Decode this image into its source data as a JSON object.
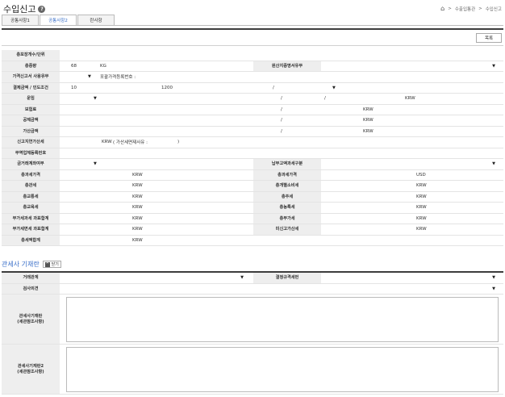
{
  "header": {
    "title": "수입신고",
    "breadcrumb": [
      "수출입통관",
      "수입신고"
    ]
  },
  "tabs": [
    {
      "label": "공통사항1",
      "active": false
    },
    {
      "label": "공통사항2",
      "active": true
    },
    {
      "label": "란사항",
      "active": false
    }
  ],
  "toolbar": {
    "close_label": "목록"
  },
  "form": {
    "total_pkg": {
      "label": "총포장개수/단위",
      "value": ""
    },
    "total_weight": {
      "label": "총중량",
      "value": "68",
      "unit": "KG"
    },
    "origin_cert": {
      "label": "원산지증명서유무",
      "value": ""
    },
    "price_decl": {
      "label": "가격신고서 사용유무",
      "value": "",
      "note": "포괄가격등록번호 :"
    },
    "settlement": {
      "label": "결제금액 / 인도조건",
      "value1": "10",
      "value2": "1200",
      "sep1": "/",
      "sep2": ""
    },
    "freight": {
      "label": "운임",
      "sep1": "/",
      "sep2": "/",
      "unit": "KRW"
    },
    "insurance": {
      "label": "보험료",
      "sep": "/",
      "unit": "KRW"
    },
    "deduction": {
      "label": "공제금액",
      "sep": "/",
      "unit": "KRW"
    },
    "addition": {
      "label": "가산금액",
      "sep": "/",
      "unit": "KRW"
    },
    "late_fee": {
      "label": "신고지연가산세",
      "unit": "KRW",
      "note": "( 가산세면제사유 :",
      "note_close": ")"
    },
    "trade_no": {
      "label": "무역업체등록번호",
      "value": ""
    },
    "amount_payment": {
      "label": "금거래계좌여부",
      "value": ""
    },
    "payment_type": {
      "label": "납부고액과세구분",
      "value": ""
    },
    "total_taxable": {
      "label": "총과세가격",
      "unit": "KRW"
    },
    "total_taxable2": {
      "label": "총과세가격",
      "unit": "USD"
    },
    "customs_duty": {
      "label": "총관세",
      "unit": "KRW"
    },
    "special_consumption": {
      "label": "총개별소비세",
      "unit": "KRW"
    },
    "traffic_tax": {
      "label": "총교통세",
      "unit": "KRW"
    },
    "liquor_tax": {
      "label": "총주세",
      "unit": "KRW"
    },
    "edu_tax": {
      "label": "총교육세",
      "unit": "KRW"
    },
    "rural_tax": {
      "label": "총농특세",
      "unit": "KRW"
    },
    "vat_base": {
      "label": "부가세과세 과표합계",
      "unit": "KRW"
    },
    "vat": {
      "label": "총부가세",
      "unit": "KRW"
    },
    "vat_exempt": {
      "label": "부가세면세 과표합계",
      "unit": "KRW"
    },
    "unreported_tax": {
      "label": "미신고가산세",
      "unit": "KRW"
    },
    "total_tax": {
      "label": "총세액합계",
      "unit": "KRW"
    }
  },
  "section2": {
    "title": "관세사 기재란",
    "toggle_label": "닫기",
    "trade_relation": {
      "label": "거래관계",
      "value": ""
    },
    "export_spec": {
      "label": "결정규격세번",
      "value": ""
    },
    "inspection": {
      "label": "검사의견",
      "value": ""
    },
    "note1": {
      "label": "관세사기재란\n(세관참조사항)",
      "value": ""
    },
    "note2": {
      "label": "관세사기재란2\n(세관참조사항)",
      "value": ""
    }
  },
  "colors": {
    "accent": "#3a6fc9",
    "label_bg": "#eeeeee",
    "header_bar": "#3d3d3d"
  },
  "icons": {
    "help": "help-icon",
    "home": "home-icon",
    "dropdown": "triangle-down-icon"
  }
}
